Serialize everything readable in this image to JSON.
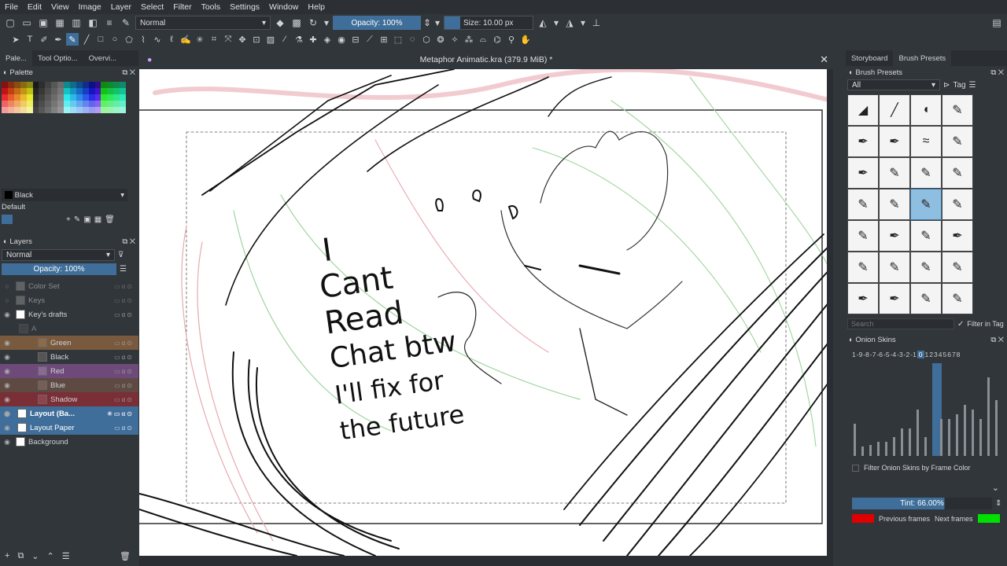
{
  "menu": [
    "File",
    "Edit",
    "View",
    "Image",
    "Layer",
    "Select",
    "Filter",
    "Tools",
    "Settings",
    "Window",
    "Help"
  ],
  "toolbar": {
    "blend_mode": "Normal",
    "opacity": "Opacity: 100%",
    "size": "Size: 10.00 px"
  },
  "left_tabs": [
    "Pale...",
    "Tool Optio...",
    "Overvi..."
  ],
  "palette": {
    "title": "Palette",
    "color_name": "Black",
    "palette_name": "Default"
  },
  "layers": {
    "title": "Layers",
    "blend_mode": "Normal",
    "opacity": "Opacity: 100%",
    "rows": [
      {
        "name": "Color Set"
      },
      {
        "name": "Keys"
      },
      {
        "name": "Key's drafts"
      },
      {
        "name": "A"
      },
      {
        "name": "Green"
      },
      {
        "name": "Black"
      },
      {
        "name": "Red"
      },
      {
        "name": "Blue"
      },
      {
        "name": "Shadow"
      },
      {
        "name": "Layout (Ba..."
      },
      {
        "name": "Layout Paper"
      },
      {
        "name": "Background"
      }
    ]
  },
  "document": {
    "title": "Metaphor Animatic.kra (379.9 MiB) *"
  },
  "canvas_text": [
    "I",
    "Cant",
    "Read",
    "Chat btw",
    "I'll fix for",
    "the future"
  ],
  "right_tabs": [
    "Storyboard",
    "Brush Presets"
  ],
  "brush_presets": {
    "title": "Brush Presets",
    "filter": "All",
    "tag_label": "Tag",
    "search_placeholder": "Search",
    "filter_in_tag": "Filter in Tag"
  },
  "onion": {
    "title": "Onion Skins",
    "frames": [
      "1",
      "-9",
      "-8",
      "-7",
      "-6",
      "-5",
      "-4",
      "-3",
      "-2",
      "-1",
      "0",
      "1",
      "2",
      "3",
      "4",
      "5",
      "6",
      "7",
      "8"
    ],
    "current": "0",
    "frame_opacity_levels": [
      0.35,
      0.1,
      0.12,
      0.15,
      0.15,
      0.2,
      0.3,
      0.3,
      0.5,
      0.2,
      1.0,
      0.4,
      0.4,
      0.45,
      0.55,
      0.5,
      0.4,
      0.85,
      0.6
    ],
    "filter_label": "Filter Onion Skins by Frame Color",
    "tint": "Tint: 66.00%",
    "previous_frames": "Previous frames",
    "next_frames": "Next frames"
  },
  "colors": {
    "accent": "#3e6e99",
    "prev_color": "#e00000",
    "next_color": "#00e000"
  }
}
